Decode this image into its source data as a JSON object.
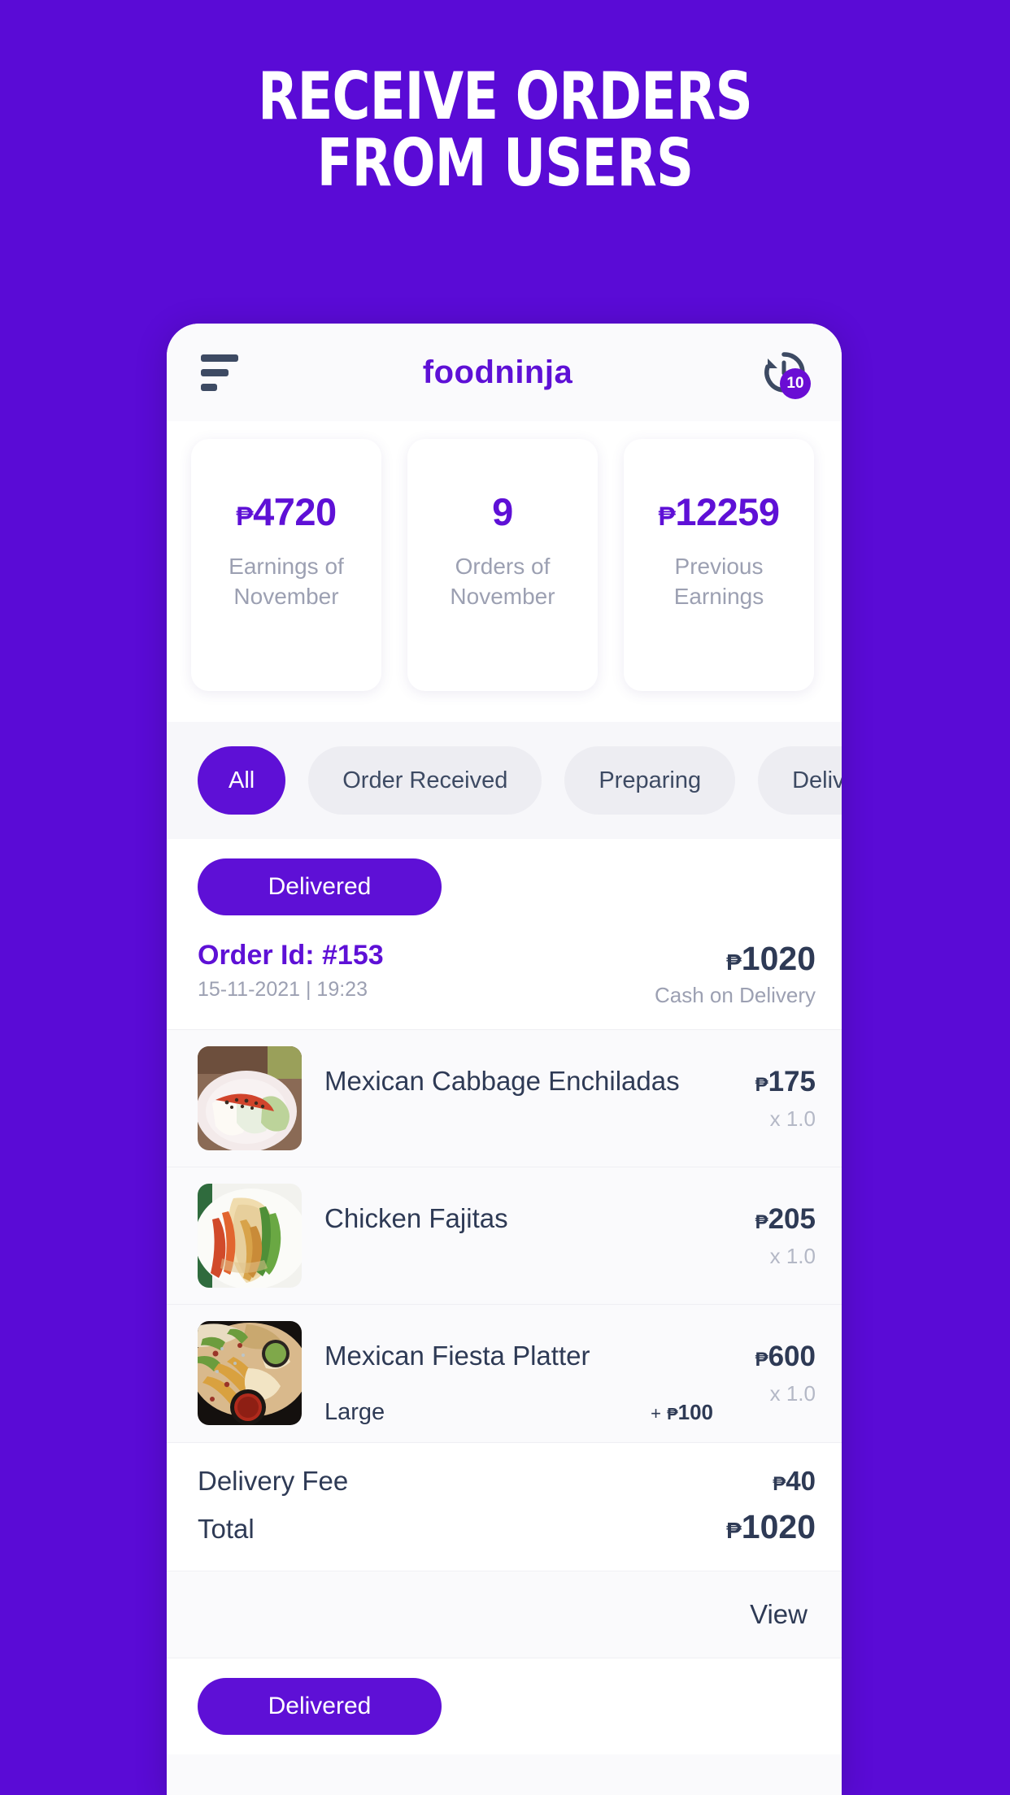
{
  "promo": {
    "line1": "RECEIVE ORDERS",
    "line2": "FROM USERS",
    "bg_color": "#5A0BD6",
    "text_color": "#FFFFFF"
  },
  "appbar": {
    "menu_icon": "hamburger-icon",
    "brand": "foodninja",
    "brand_color": "#5E10D6",
    "history_icon": "history-clock-icon",
    "history_badge": "10"
  },
  "stats": [
    {
      "value": "4720",
      "currency": "₱",
      "has_currency": true,
      "label": "Earnings of November"
    },
    {
      "value": "9",
      "currency": "₱",
      "has_currency": false,
      "label": "Orders of November"
    },
    {
      "value": "12259",
      "currency": "₱",
      "has_currency": true,
      "label": "Previous Earnings"
    }
  ],
  "filters": [
    {
      "label": "All",
      "active": true
    },
    {
      "label": "Order Received",
      "active": false
    },
    {
      "label": "Preparing",
      "active": false
    },
    {
      "label": "Delivering",
      "active": false
    }
  ],
  "order": {
    "status": "Delivered",
    "id_label": "Order Id: #153",
    "datetime": "15-11-2021 | 19:23",
    "amount": "1020",
    "currency": "₱",
    "payment_method": "Cash on Delivery",
    "items": [
      {
        "name": "Mexican Cabbage Enchiladas",
        "price": "175",
        "qty": "x 1.0",
        "variant": "",
        "extra": "",
        "thumb": "enchiladas-photo"
      },
      {
        "name": "Chicken Fajitas",
        "price": "205",
        "qty": "x 1.0",
        "variant": "",
        "extra": "",
        "thumb": "fajitas-photo"
      },
      {
        "name": "Mexican Fiesta Platter",
        "price": "600",
        "qty": "x 1.0",
        "variant": "Large",
        "extra": "100",
        "thumb": "fiesta-platter-photo"
      }
    ],
    "delivery_fee_label": "Delivery Fee",
    "delivery_fee": "40",
    "total_label": "Total",
    "total": "1020",
    "view_label": "View"
  },
  "next_order": {
    "status": "Delivered"
  },
  "colors": {
    "brand_purple": "#5E10D6",
    "page_purple": "#5A0BD6",
    "ink": "#2E3A55",
    "muted": "#9CA0B2",
    "chip_bg": "#EDEDF2"
  }
}
